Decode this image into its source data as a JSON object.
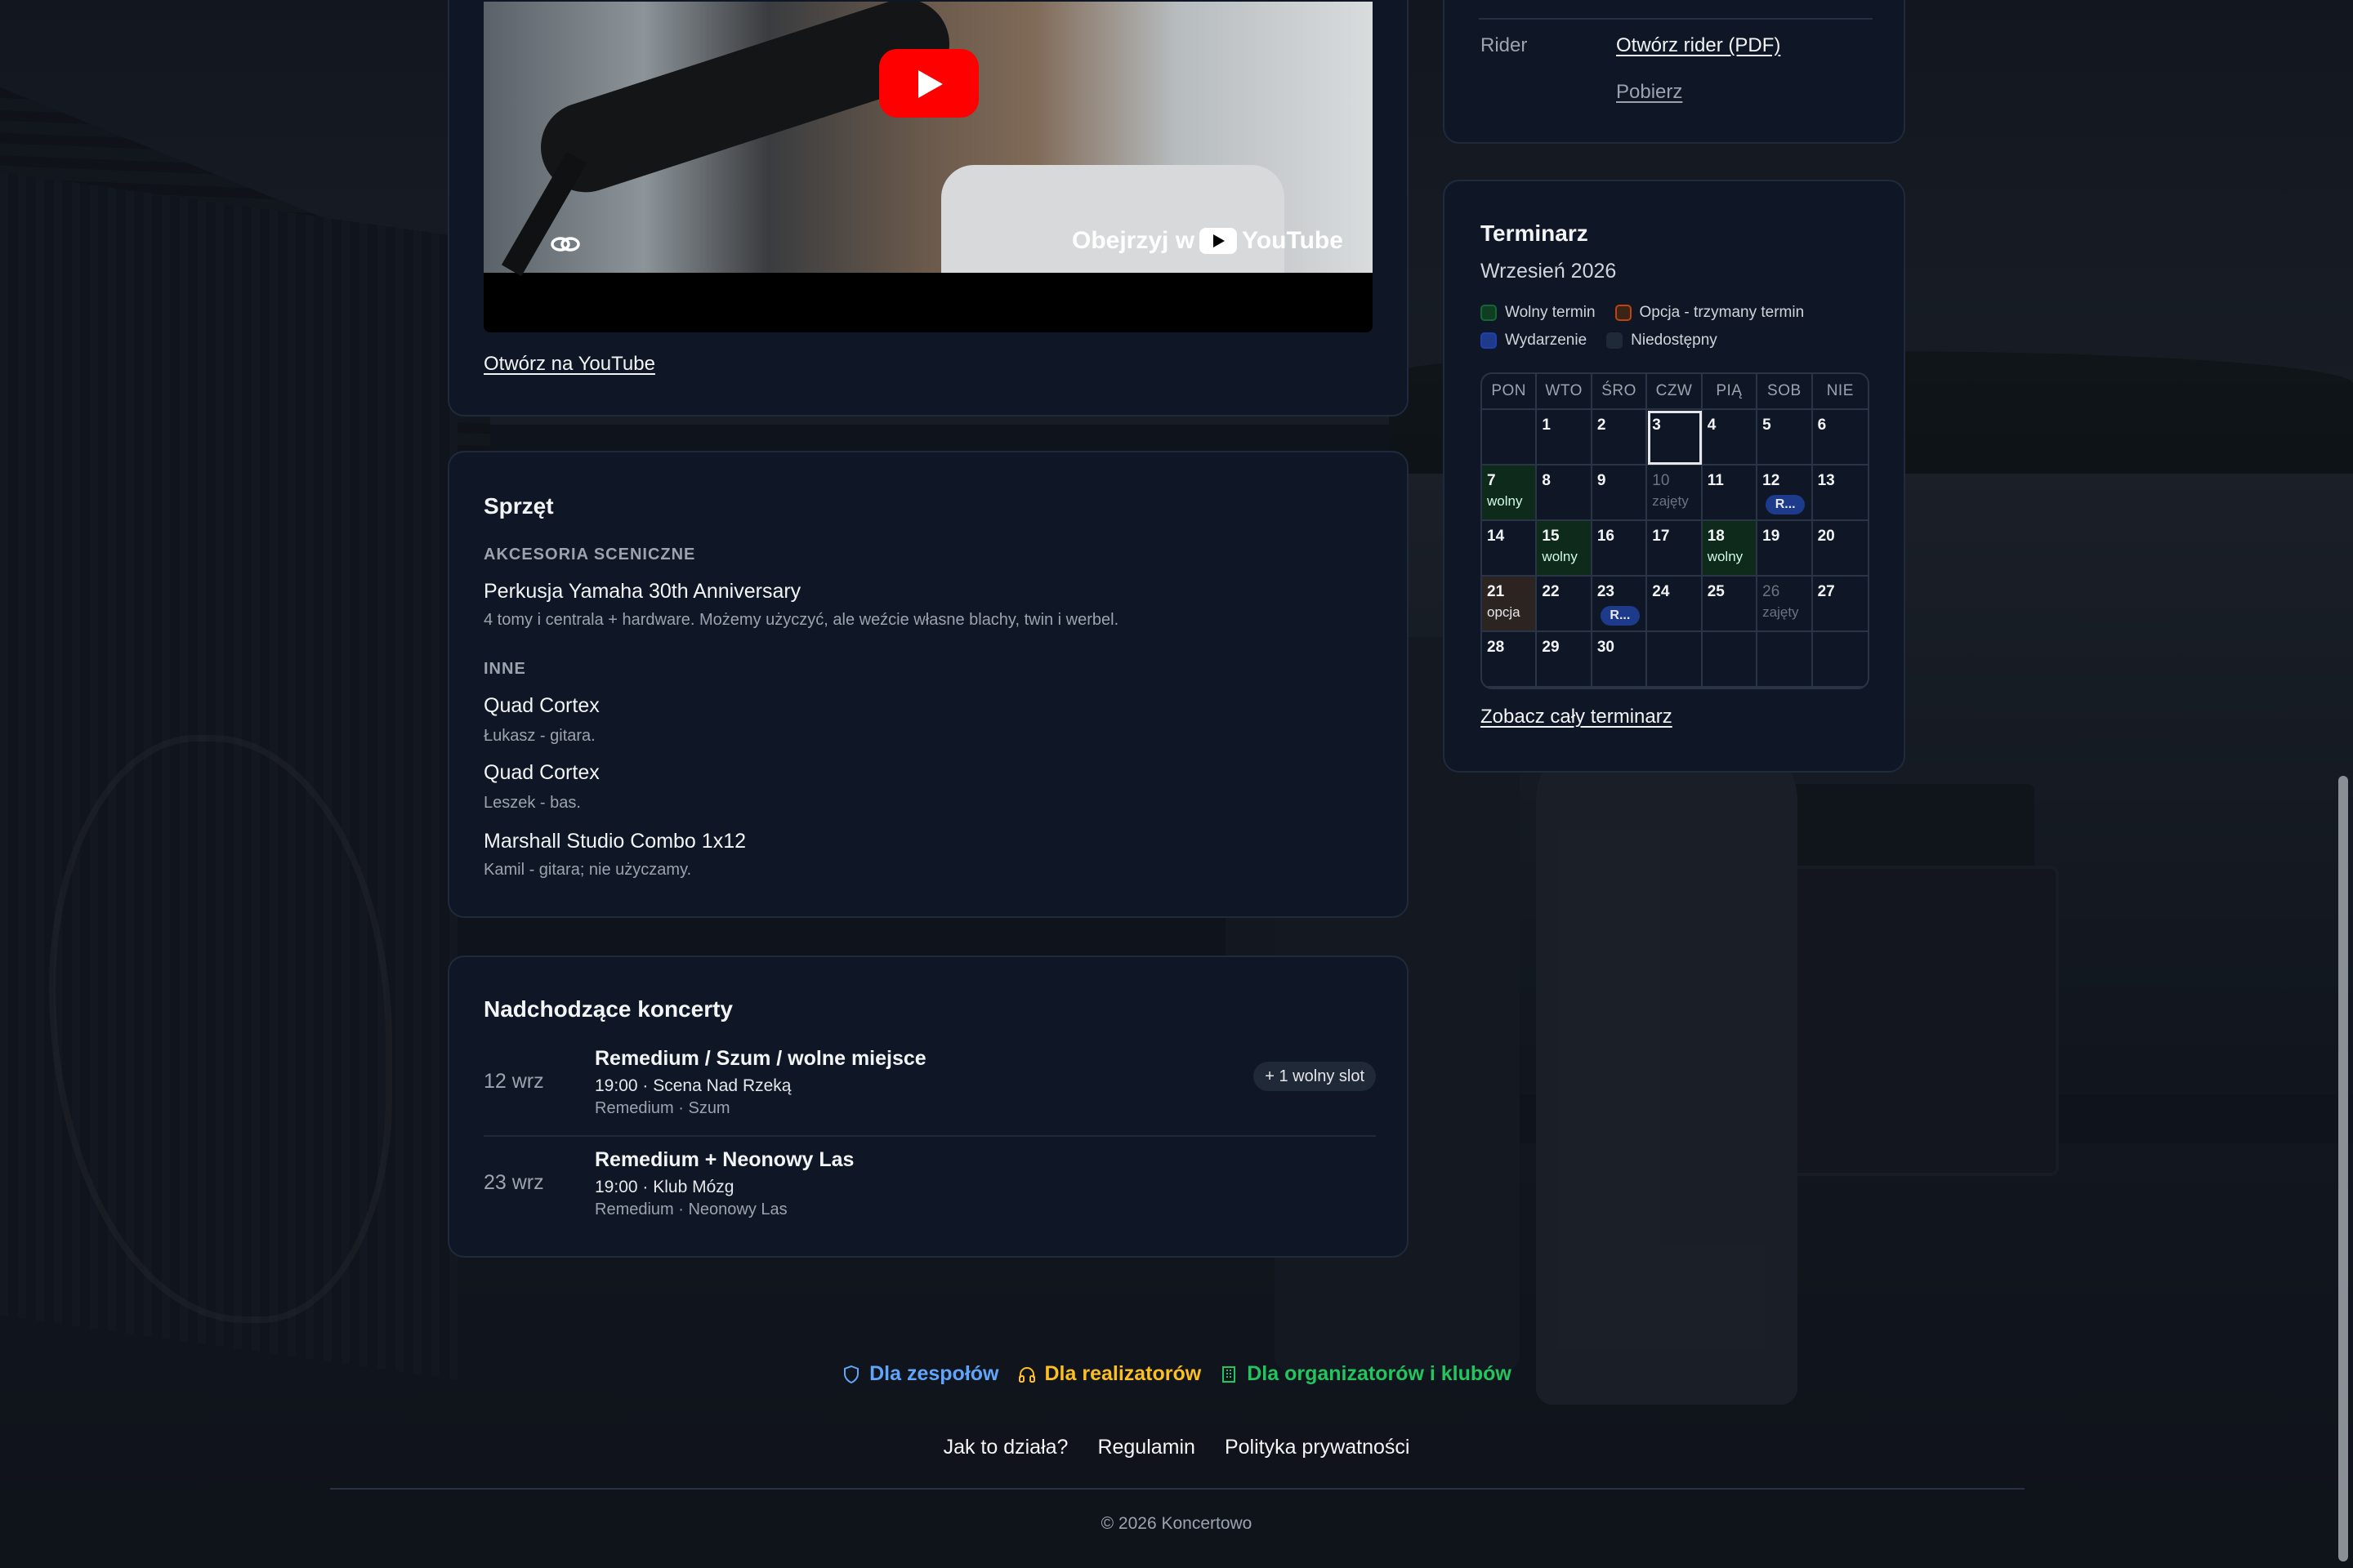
{
  "video": {
    "watch_on": "Obejrzyj w",
    "youtube_wordmark": "YouTube",
    "open_link": "Otwórz na YouTube"
  },
  "rider": {
    "label": "Rider",
    "open_link": "Otwórz rider (PDF)",
    "download_link": "Pobierz"
  },
  "calendar": {
    "title": "Terminarz",
    "month": "Wrzesień 2026",
    "legend": [
      {
        "label": "Wolny termin",
        "color": "#0f3d22",
        "border": "#166534"
      },
      {
        "label": "Opcja - trzymany termin",
        "color": "#3a2416",
        "border": "#c2410c"
      },
      {
        "label": "Wydarzenie",
        "color": "#1e3a8a",
        "border": "#1e40af"
      },
      {
        "label": "Niedostępny",
        "color": "#1f2937",
        "border": "#1f2937"
      }
    ],
    "weekdays": [
      "PON",
      "WTO",
      "ŚRO",
      "CZW",
      "PIĄ",
      "SOB",
      "NIE"
    ],
    "cells": [
      {
        "day": "",
        "status": ""
      },
      {
        "day": "1",
        "status": ""
      },
      {
        "day": "2",
        "status": ""
      },
      {
        "day": "3",
        "status": "today"
      },
      {
        "day": "4",
        "status": ""
      },
      {
        "day": "5",
        "status": ""
      },
      {
        "day": "6",
        "status": ""
      },
      {
        "day": "7",
        "status": "free",
        "tag": "wolny"
      },
      {
        "day": "8",
        "status": ""
      },
      {
        "day": "9",
        "status": ""
      },
      {
        "day": "10",
        "status": "busy",
        "tag": "zajęty"
      },
      {
        "day": "11",
        "status": ""
      },
      {
        "day": "12",
        "status": "event",
        "event": "R..."
      },
      {
        "day": "13",
        "status": ""
      },
      {
        "day": "14",
        "status": ""
      },
      {
        "day": "15",
        "status": "free",
        "tag": "wolny"
      },
      {
        "day": "16",
        "status": ""
      },
      {
        "day": "17",
        "status": ""
      },
      {
        "day": "18",
        "status": "free",
        "tag": "wolny"
      },
      {
        "day": "19",
        "status": ""
      },
      {
        "day": "20",
        "status": ""
      },
      {
        "day": "21",
        "status": "option",
        "tag": "opcja"
      },
      {
        "day": "22",
        "status": ""
      },
      {
        "day": "23",
        "status": "event",
        "event": "R..."
      },
      {
        "day": "24",
        "status": ""
      },
      {
        "day": "25",
        "status": ""
      },
      {
        "day": "26",
        "status": "busy",
        "tag": "zajęty"
      },
      {
        "day": "27",
        "status": ""
      },
      {
        "day": "28",
        "status": ""
      },
      {
        "day": "29",
        "status": ""
      },
      {
        "day": "30",
        "status": ""
      },
      {
        "day": "",
        "status": ""
      },
      {
        "day": "",
        "status": ""
      },
      {
        "day": "",
        "status": ""
      },
      {
        "day": "",
        "status": ""
      }
    ],
    "see_all": "Zobacz cały terminarz"
  },
  "gear": {
    "title": "Sprzęt",
    "sections": [
      {
        "heading": "AKCESORIA SCENICZNE",
        "items": [
          {
            "name": "Perkusja Yamaha 30th Anniversary",
            "desc": "4 tomy i centrala + hardware. Możemy użyczyć, ale weźcie własne blachy, twin i werbel."
          }
        ]
      },
      {
        "heading": "INNE",
        "items": [
          {
            "name": "Quad Cortex",
            "desc": "Łukasz - gitara."
          },
          {
            "name": "Quad Cortex",
            "desc": "Leszek - bas."
          },
          {
            "name": "Marshall Studio Combo 1x12",
            "desc": "Kamil - gitara; nie użyczamy."
          }
        ]
      }
    ]
  },
  "concerts": {
    "title": "Nadchodzące koncerty",
    "items": [
      {
        "date": "12 wrz",
        "title": "Remedium / Szum / wolne miejsce",
        "meta": "19:00 · Scena Nad Rzeką",
        "bands": "Remedium · Szum",
        "badge": "+ 1 wolny slot"
      },
      {
        "date": "23 wrz",
        "title": "Remedium + Neonowy Las",
        "meta": "19:00 · Klub Mózg",
        "bands": "Remedium · Neonowy Las",
        "badge": ""
      }
    ]
  },
  "footer": {
    "audience_links": [
      {
        "label": "Dla zespołów",
        "color": "#60a5fa",
        "icon": "shield-icon"
      },
      {
        "label": "Dla realizatorów",
        "color": "#fbbf24",
        "icon": "headphones-icon"
      },
      {
        "label": "Dla organizatorów i klubów",
        "color": "#22c55e",
        "icon": "building-icon"
      }
    ],
    "nav": [
      "Jak to działa?",
      "Regulamin",
      "Polityka prywatności"
    ],
    "copyright": "© 2026 Koncertowo"
  }
}
